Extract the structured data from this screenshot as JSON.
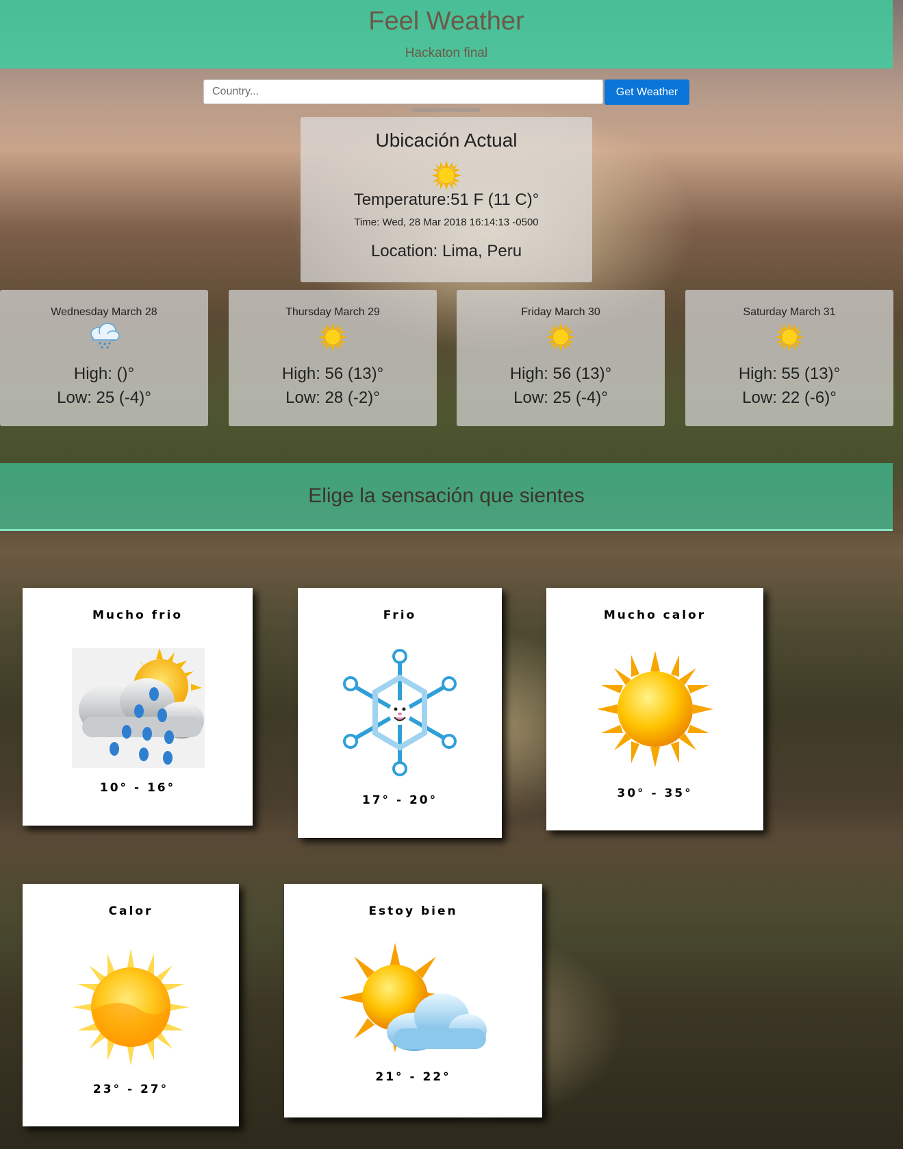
{
  "header": {
    "title": "Feel Weather",
    "subtitle": "Hackaton final"
  },
  "search": {
    "placeholder": "Country...",
    "button_label": "Get Weather"
  },
  "current": {
    "heading": "Ubicación Actual",
    "icon": "sun-icon",
    "temperature": "Temperature:51 F (11 C)°",
    "time": "Time: Wed, 28 Mar 2018 16:14:13 -0500",
    "location": "Location: Lima, Peru"
  },
  "forecast": [
    {
      "day": "Wednesday March 28",
      "icon": "rain-cloud-icon",
      "high": "High: ()°",
      "low": "Low: 25 (-4)°"
    },
    {
      "day": "Thursday March 29",
      "icon": "sun-icon",
      "high": "High: 56 (13)°",
      "low": "Low: 28 (-2)°"
    },
    {
      "day": "Friday March 30",
      "icon": "sun-icon",
      "high": "High: 56 (13)°",
      "low": "Low: 25 (-4)°"
    },
    {
      "day": "Saturday March 31",
      "icon": "sun-icon",
      "high": "High: 55 (13)°",
      "low": "Low: 22 (-6)°"
    }
  ],
  "feel_banner": "Elige la sensación que sientes",
  "feelings": [
    {
      "title": "Mucho frio",
      "range": "10° - 16°",
      "icon": "sun-cloud-rain-icon"
    },
    {
      "title": "Frio",
      "range": "17° - 20°",
      "icon": "snowflake-icon"
    },
    {
      "title": "Mucho calor",
      "range": "30° - 35°",
      "icon": "sun-icon"
    },
    {
      "title": "Calor",
      "range": "23° - 27°",
      "icon": "sun-icon"
    },
    {
      "title": "Estoy bien",
      "range": "21° - 22°",
      "icon": "sun-cloud-icon"
    }
  ],
  "colors": {
    "header_bg": "#3ccea0",
    "button_bg": "#0a75d9",
    "sun": "#f6c600"
  }
}
